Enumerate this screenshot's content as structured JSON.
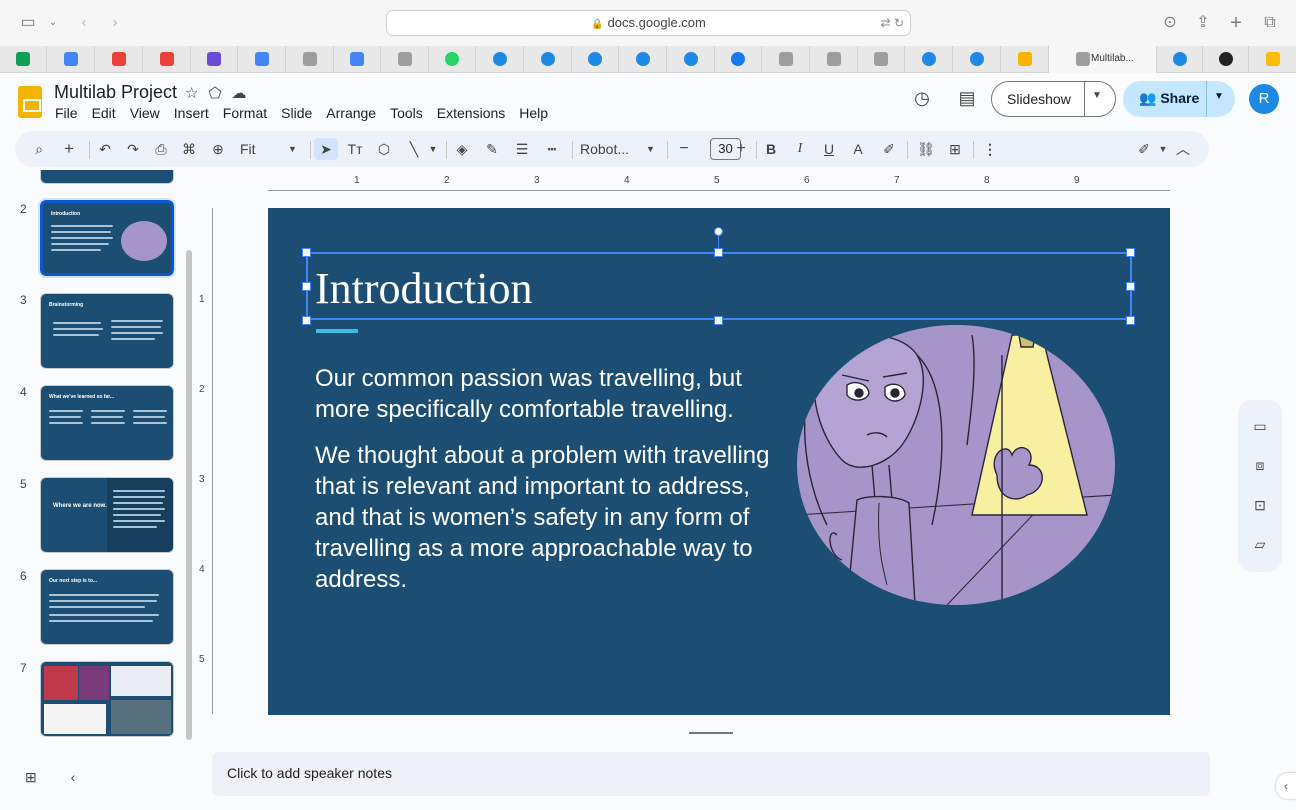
{
  "browser": {
    "url": "docs.google.com",
    "active_tab_title": "Multilab..."
  },
  "app": {
    "doc_title": "Multilab Project",
    "menu": [
      "File",
      "Edit",
      "View",
      "Insert",
      "Format",
      "Slide",
      "Arrange",
      "Tools",
      "Extensions",
      "Help"
    ],
    "slideshow_label": "Slideshow",
    "share_label": "Share",
    "avatar_initial": "R"
  },
  "toolbar": {
    "zoom": "Fit",
    "font": "Robot...",
    "font_size": "30"
  },
  "filmstrip": {
    "slides": [
      {
        "number": "2",
        "title": "Introduction"
      },
      {
        "number": "3",
        "title": "Brainstorming"
      },
      {
        "number": "4",
        "title": "What we've learned so far..."
      },
      {
        "number": "5",
        "title": "Where we are now..."
      },
      {
        "number": "6",
        "title": "Our next step is to..."
      },
      {
        "number": "7",
        "title": ""
      }
    ]
  },
  "ruler": {
    "horizontal": [
      "1",
      "2",
      "3",
      "4",
      "5",
      "6",
      "7",
      "8",
      "9"
    ],
    "vertical": [
      "1",
      "2",
      "3",
      "4",
      "5"
    ]
  },
  "slide": {
    "title": "Introduction",
    "paragraph_1": "Our common passion was travelling, but more specifically comfortable travelling.",
    "paragraph_2": "We thought about a problem with travelling that is relevant and important to address, and that is women’s safety in any form of travelling as a more approachable way to address."
  },
  "notes": {
    "placeholder": "Click to add speaker notes"
  },
  "colors": {
    "slide_bg": "#1b4e72",
    "accent": "#3dbde0",
    "selection": "#4285f4",
    "illustration_circle": "#a595c8"
  }
}
